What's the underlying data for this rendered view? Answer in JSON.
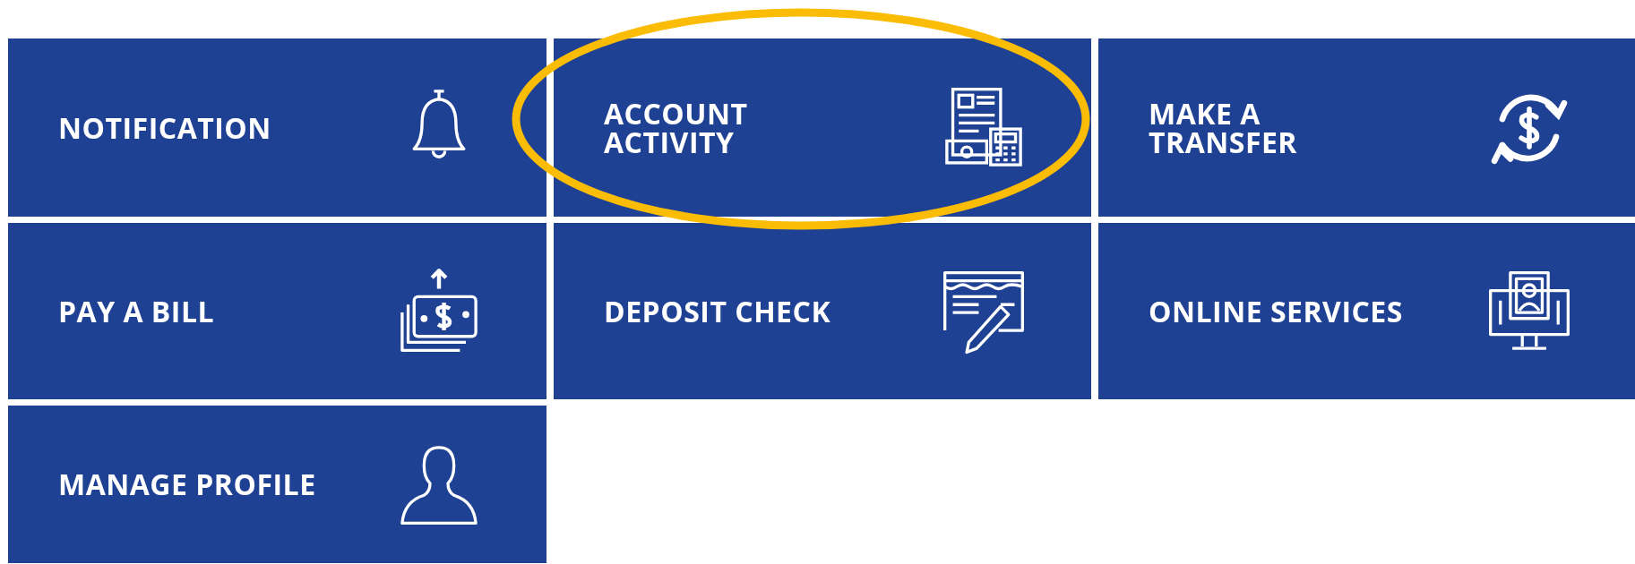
{
  "tiles": [
    {
      "label_lines": [
        "NOTIFICATION"
      ],
      "highlighted": false
    },
    {
      "label_lines": [
        "ACCOUNT",
        "ACTIVITY"
      ],
      "highlighted": true
    },
    {
      "label_lines": [
        "MAKE A",
        "TRANSFER"
      ],
      "highlighted": false
    },
    {
      "label_lines": [
        "PAY A BILL"
      ],
      "highlighted": false
    },
    {
      "label_lines": [
        "DEPOSIT CHECK"
      ],
      "highlighted": false
    },
    {
      "label_lines": [
        "ONLINE SERVICES"
      ],
      "highlighted": false
    },
    {
      "label_lines": [
        "MANAGE PROFILE"
      ],
      "highlighted": false
    }
  ]
}
